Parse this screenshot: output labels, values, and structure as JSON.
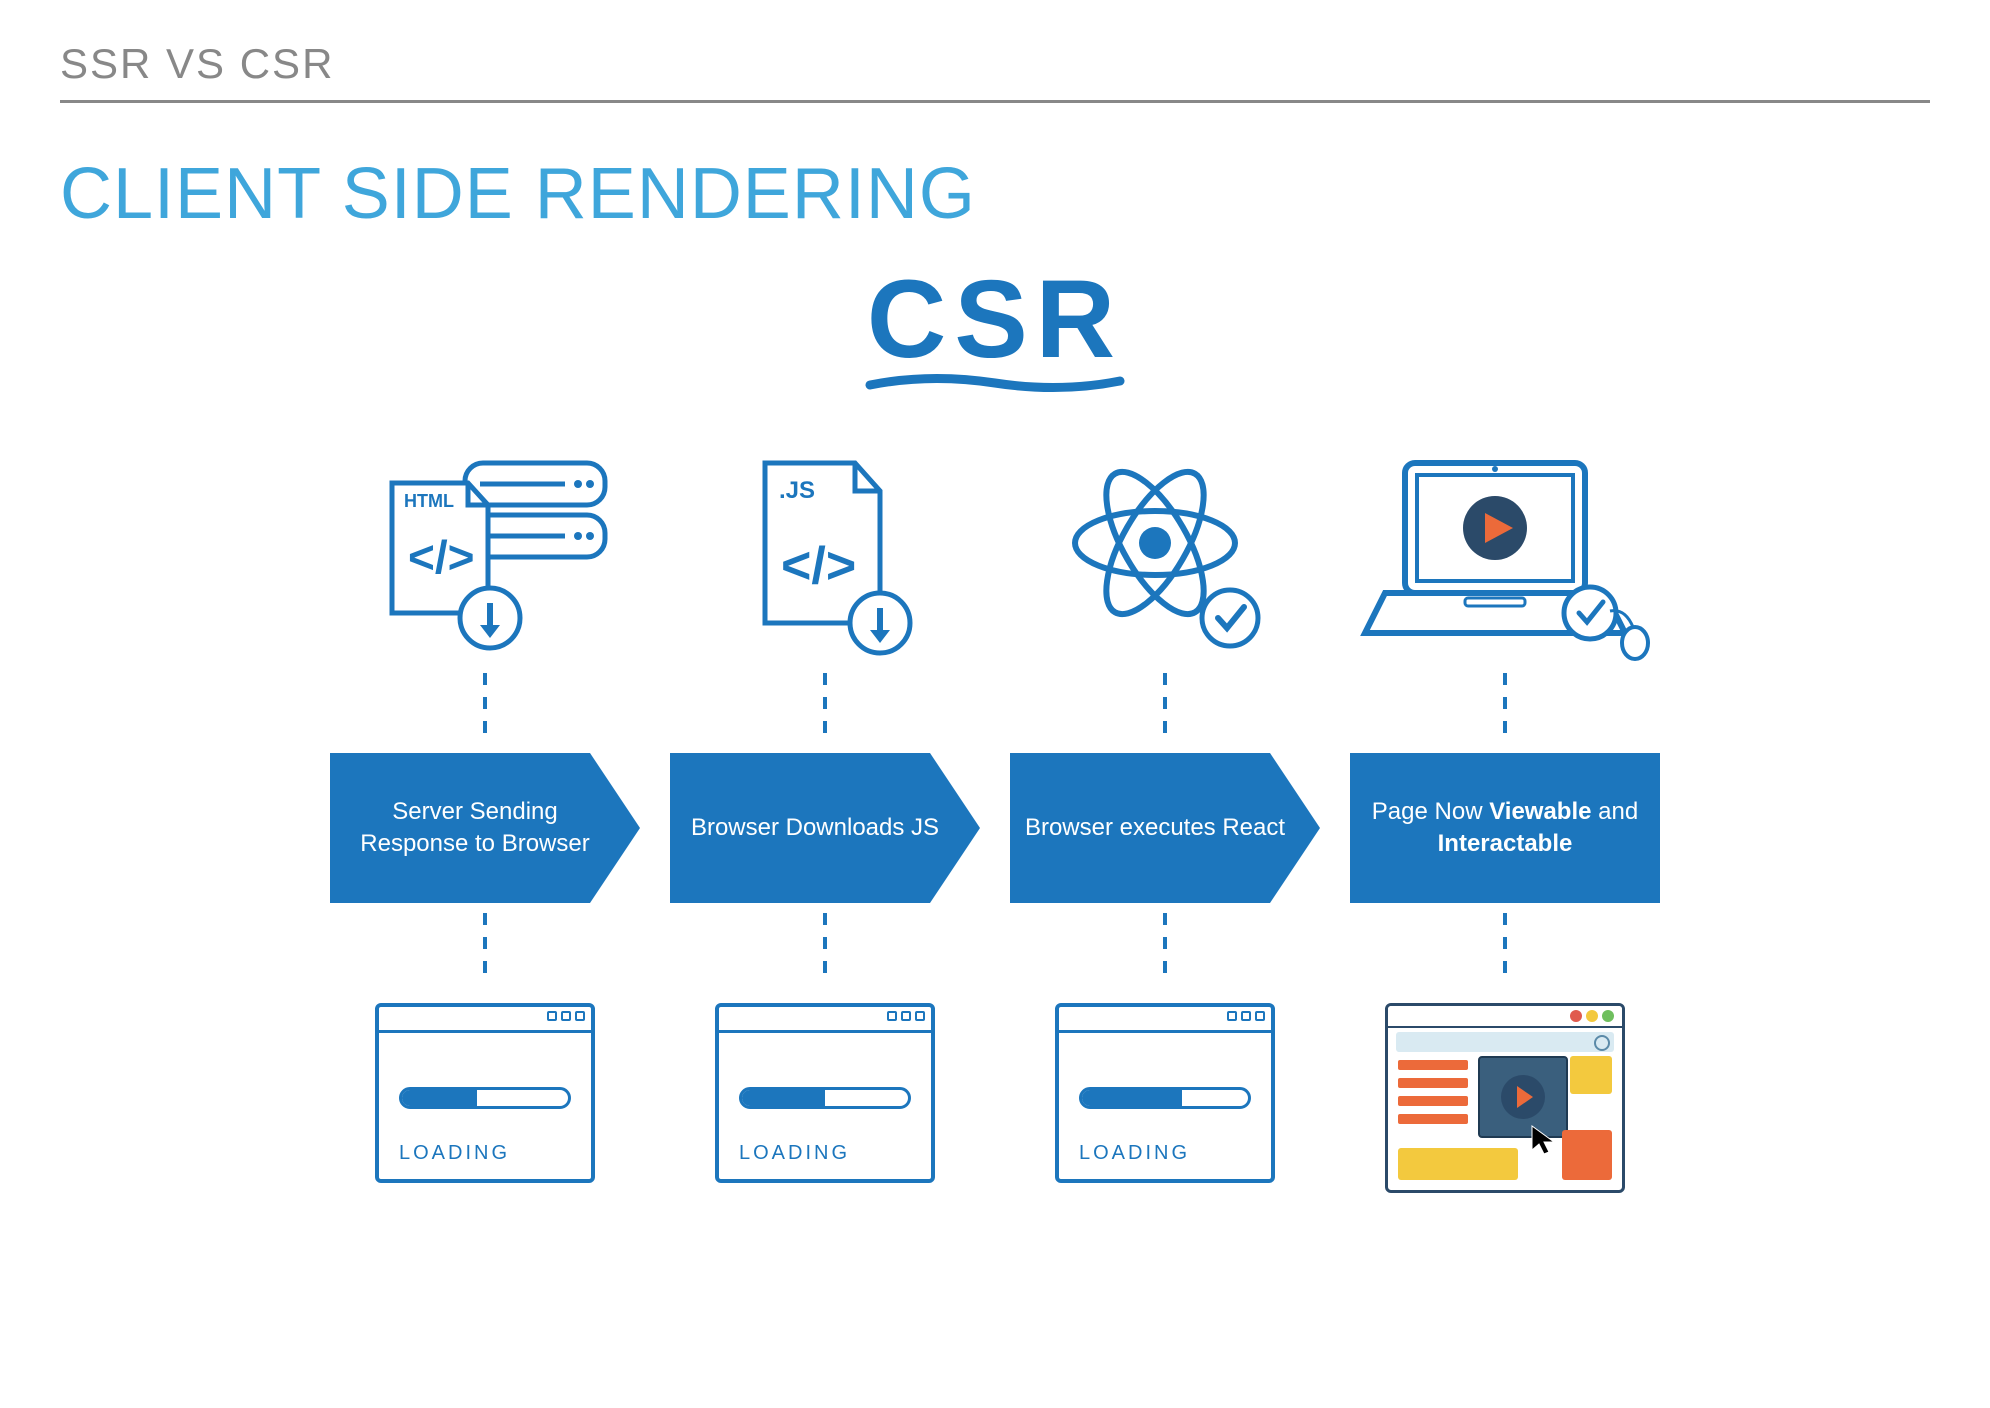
{
  "header": {
    "label": "SSR VS CSR"
  },
  "title": "CLIENT SIDE RENDERING",
  "diagram": {
    "acronym": "CSR",
    "steps": [
      {
        "icon": "html-server-download-icon",
        "icon_badge": "HTML",
        "label_html": "Server Sending Response to Browser",
        "result_type": "loading",
        "result_label": "LOADING",
        "progress": 45
      },
      {
        "icon": "js-file-download-icon",
        "icon_badge": ".JS",
        "label_html": "Browser Downloads JS",
        "result_type": "loading",
        "result_label": "LOADING",
        "progress": 50
      },
      {
        "icon": "react-logo-icon",
        "icon_badge": "",
        "label_html": "Browser executes React",
        "result_type": "loading",
        "result_label": "LOADING",
        "progress": 60
      },
      {
        "icon": "laptop-play-icon",
        "icon_badge": "",
        "label_html": "Page Now <b>Viewable</b> and <b>Interactable</b>",
        "result_type": "rendered",
        "result_label": "",
        "progress": 100
      }
    ]
  },
  "colors": {
    "brand_blue": "#1c76bd",
    "light_blue": "#3fa6db",
    "gray": "#888",
    "orange": "#ec6a3a",
    "yellow": "#f3c93e",
    "navy": "#2b4a69"
  }
}
